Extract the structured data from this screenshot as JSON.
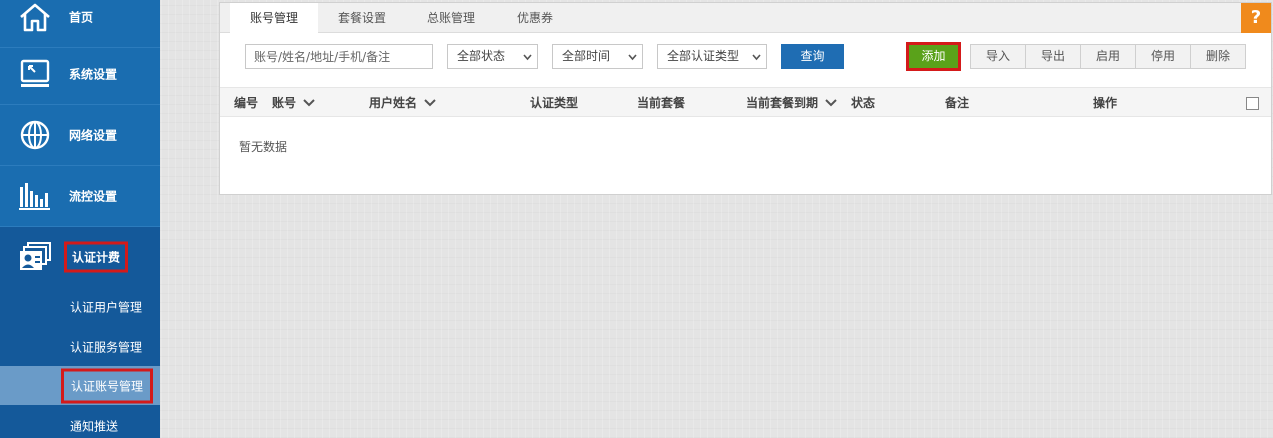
{
  "sidebar": {
    "items": [
      {
        "label": "首页",
        "icon": "home-icon"
      },
      {
        "label": "系统设置",
        "icon": "monitor-icon"
      },
      {
        "label": "网络设置",
        "icon": "globe-icon"
      },
      {
        "label": "流控设置",
        "icon": "bar-chart-icon"
      },
      {
        "label": "认证计费",
        "icon": "id-card-icon"
      }
    ],
    "submenu": [
      {
        "label": "认证用户管理"
      },
      {
        "label": "认证服务管理"
      },
      {
        "label": "认证账号管理"
      },
      {
        "label": "通知推送"
      }
    ]
  },
  "tabs": [
    "账号管理",
    "套餐设置",
    "总账管理",
    "优惠券"
  ],
  "help_label": "?",
  "toolbar": {
    "search_placeholder": "账号/姓名/地址/手机/备注",
    "status_select": "全部状态",
    "time_select": "全部时间",
    "auth_type_select": "全部认证类型",
    "query_label": "查询",
    "add_label": "添加",
    "actions": [
      "导入",
      "导出",
      "启用",
      "停用",
      "删除"
    ]
  },
  "table": {
    "columns": [
      "编号",
      "账号",
      "用户姓名",
      "认证类型",
      "当前套餐",
      "当前套餐到期",
      "状态",
      "备注",
      "操作"
    ],
    "empty_text": "暂无数据"
  },
  "colors": {
    "sidebar": "#1a6db0",
    "highlight": "#d41a1a",
    "add_button": "#5aa21a",
    "query_button": "#1f6db3",
    "help_button": "#f08a1c"
  }
}
